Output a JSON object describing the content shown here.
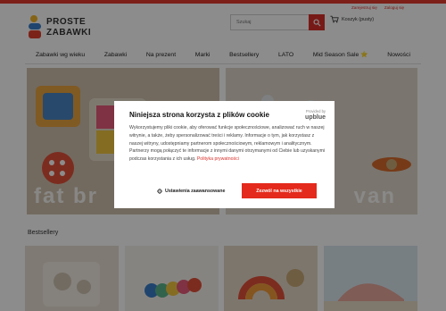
{
  "account": {
    "register": "Zarejestruj się",
    "login": "Zaloguj się"
  },
  "logo": {
    "line1": "PROSTE",
    "line2": "ZABAWKI"
  },
  "search": {
    "placeholder": "Szukaj"
  },
  "cart": {
    "label": "Koszyk (pusty)"
  },
  "nav": [
    "Zabawki wg wieku",
    "Zabawki",
    "Na prezent",
    "Marki",
    "Bestsellery",
    "LATO",
    "Mid Season Sale ⭐",
    "Nowości"
  ],
  "banners": {
    "left_text": "fat br",
    "right_text": "van"
  },
  "bestsellers": {
    "title": "Bestsellery"
  },
  "cookie": {
    "title": "Niniejsza strona korzysta z plików cookie",
    "powered_by": "Provided by",
    "powered_brand": "upblue",
    "body": "Wykorzystujemy pliki cookie, aby oferować funkcje społecznościowe, analizować ruch w naszej witrynie, a także, żeby spersonalizować treści i reklamy. Informacje o tym, jak korzystasz z naszej witryny, udostępniamy partnerom społecznościowym, reklamowym i analitycznym. Partnerzy mogą połączyć te informacje z innymi danymi otrzymanymi od Ciebie lub uzyskanymi podczas korzystania z ich usług.",
    "privacy_link": "Polityka prywatności",
    "settings_label": "Ustawienia zaawansowane",
    "accept_label": "Zezwól na wszystkie"
  },
  "colors": {
    "brand_red": "#e42a1c",
    "overlay": "rgba(0,0,0,0.45)"
  }
}
